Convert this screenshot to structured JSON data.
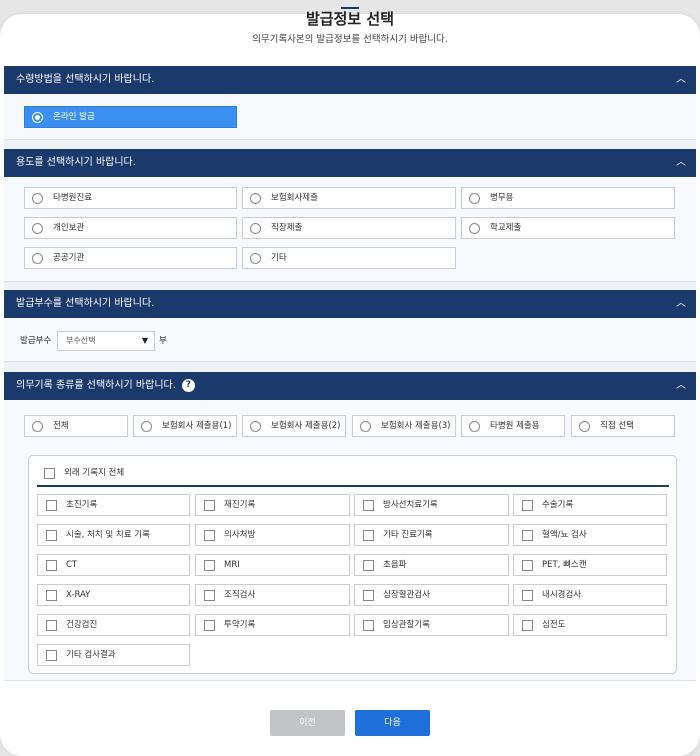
{
  "page": {
    "title": "발급정보 선택",
    "subtitle": "의무기록사본의 발급정보를 선택하시기 바랍니다."
  },
  "receipt": {
    "heading": "수령방법을 선택하시기 바랍니다.",
    "options": [
      {
        "label": "온라인 발급",
        "selected": true
      }
    ]
  },
  "purpose": {
    "heading": "용도를 선택하시기 바랍니다.",
    "options": [
      "타병원진료",
      "보험회사제출",
      "병무용",
      "개인보관",
      "직장제출",
      "학교제출",
      "공공기관",
      "기타"
    ]
  },
  "copies": {
    "heading": "발급부수를 선택하시기 바랍니다.",
    "label": "발급부수",
    "placeholder": "부수선택",
    "unit": "부"
  },
  "records": {
    "heading": "의무기록 종류를 선택하시기 바랍니다.",
    "help": "?",
    "types": [
      "전체",
      "보험회사 제출용(1)",
      "보험회사 제출용(2)",
      "보험회사 제출용(3)",
      "타병원 제출용",
      "직접 선택"
    ],
    "all_label": "외래 기록지 전체",
    "items": [
      "초진기록",
      "재진기록",
      "방사선치료기록",
      "수술기록",
      "시술, 처치 및 치료 기록",
      "의사처방",
      "기타 진료기록",
      "혈액/뇨 검사",
      "CT",
      "MRI",
      "초음파",
      "PET, 뼈스캔",
      "X-RAY",
      "조직검사",
      "심장혈관검사",
      "내시경검사",
      "건강검진",
      "투약기록",
      "임상관찰기록",
      "심전도",
      "기타 검사결과"
    ]
  },
  "footer": {
    "prev_label": "이전",
    "next_label": "다음"
  },
  "colors": {
    "header_navy": "#1a3a6b",
    "selected_blue": "#3b8ff0",
    "primary_button": "#1e6fd9",
    "disabled_button": "#c2c4c8"
  },
  "icons": {
    "collapse": "chevron-up-icon",
    "dropdown": "caret-down-icon",
    "help": "question-circle-icon"
  }
}
